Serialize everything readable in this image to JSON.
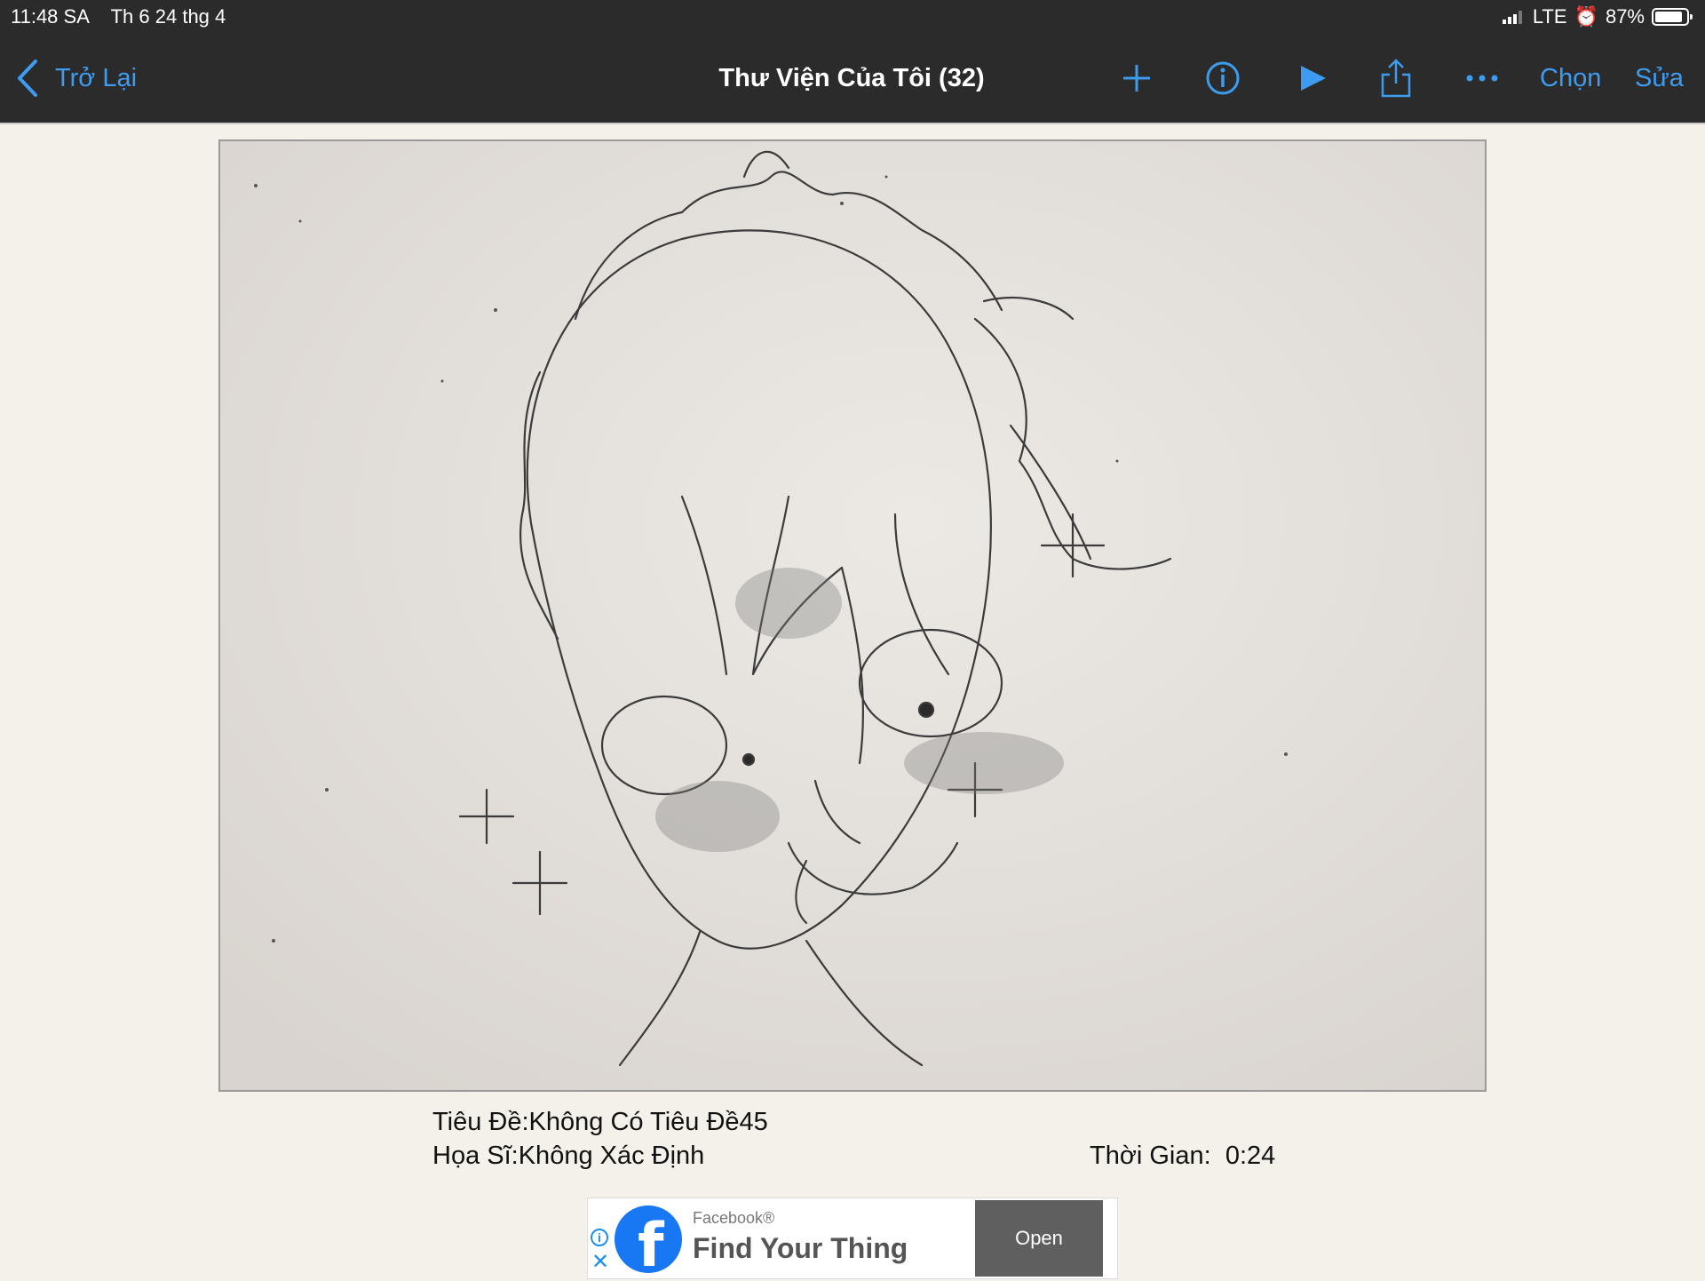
{
  "status_bar": {
    "time": "11:48 SA",
    "date": "Th 6 24 thg 4",
    "network": "LTE",
    "battery": "87%",
    "battery_level": 0.87
  },
  "nav": {
    "back_label": "Trở Lại",
    "title": "Thư Viện Của Tôi (32)",
    "select_label": "Chọn",
    "edit_label": "Sửa",
    "icons": [
      "plus-icon",
      "info-icon",
      "play-icon",
      "share-icon",
      "more-icon"
    ],
    "accent_color": "#3d9cf0"
  },
  "artwork": {
    "description_icon": "pencil-sketch-image"
  },
  "info": {
    "title_label": "Tiêu Đề:",
    "title_value": "Không Có Tiêu Đề45",
    "artist_label": "Họa Sĩ:",
    "artist_value": "Không Xác Định",
    "time_label": "Thời Gian:",
    "time_value": "0:24"
  },
  "ad": {
    "sponsor": "Facebook®",
    "headline": "Find Your Thing",
    "cta": "Open",
    "brand_color": "#1877f2"
  }
}
